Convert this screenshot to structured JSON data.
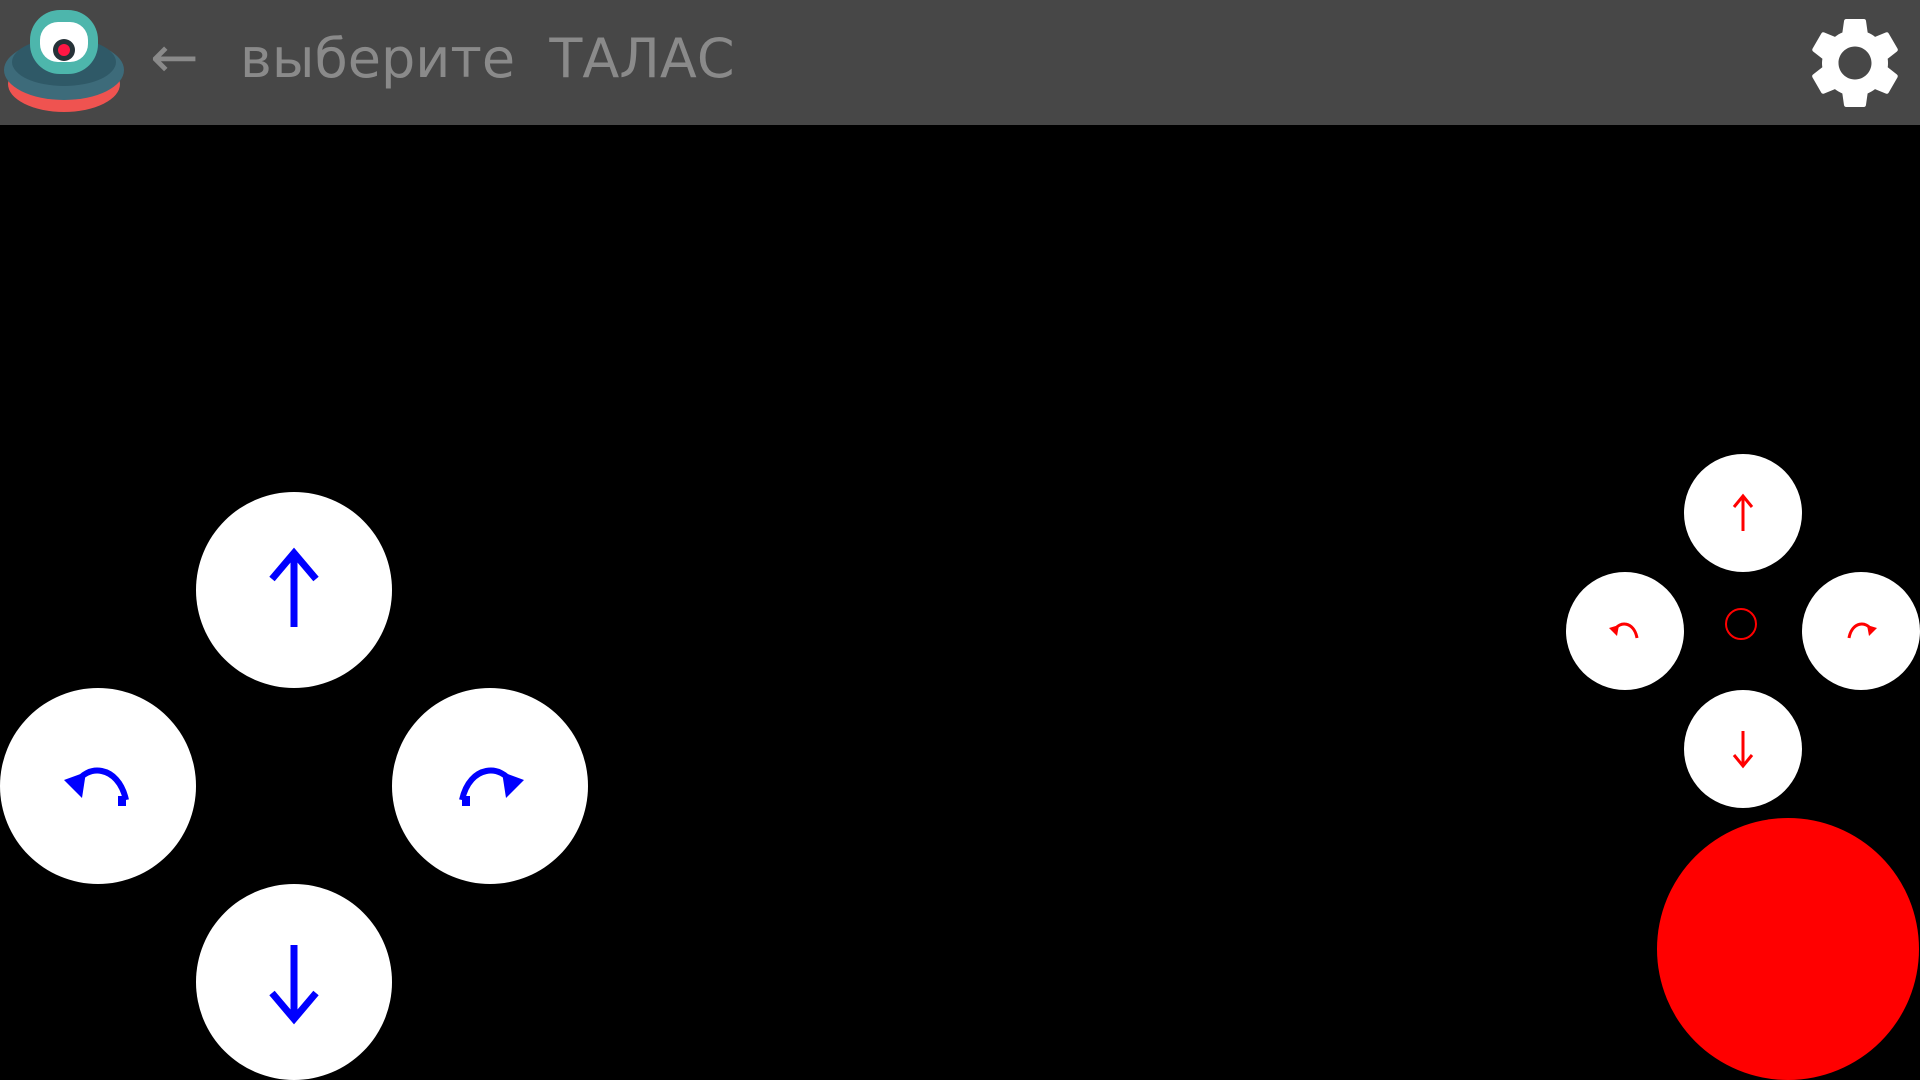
{
  "header": {
    "back_glyph": "←",
    "title": "выберите  ТАЛАС",
    "logo_icon": "robot-app-logo",
    "settings_icon": "gear-icon"
  },
  "left_pad": {
    "color": "#0000ff",
    "buttons": [
      {
        "name": "forward",
        "icon": "arrow-up-icon"
      },
      {
        "name": "turn-left",
        "icon": "rotate-left-icon"
      },
      {
        "name": "turn-right",
        "icon": "rotate-right-icon"
      },
      {
        "name": "backward",
        "icon": "arrow-down-icon"
      }
    ]
  },
  "right_pad": {
    "color": "#ff0000",
    "buttons": [
      {
        "name": "up",
        "icon": "arrow-up-icon"
      },
      {
        "name": "rotate-left",
        "icon": "rotate-left-icon"
      },
      {
        "name": "center",
        "icon": "circle-icon"
      },
      {
        "name": "rotate-right",
        "icon": "rotate-right-icon"
      },
      {
        "name": "down",
        "icon": "arrow-down-icon"
      }
    ]
  },
  "action_button": {
    "color": "#ff0000",
    "icon": "record-button"
  },
  "colors": {
    "topbar": "#474747",
    "header_text": "#8a8a8a",
    "background": "#000000",
    "pad_button": "#ffffff"
  }
}
